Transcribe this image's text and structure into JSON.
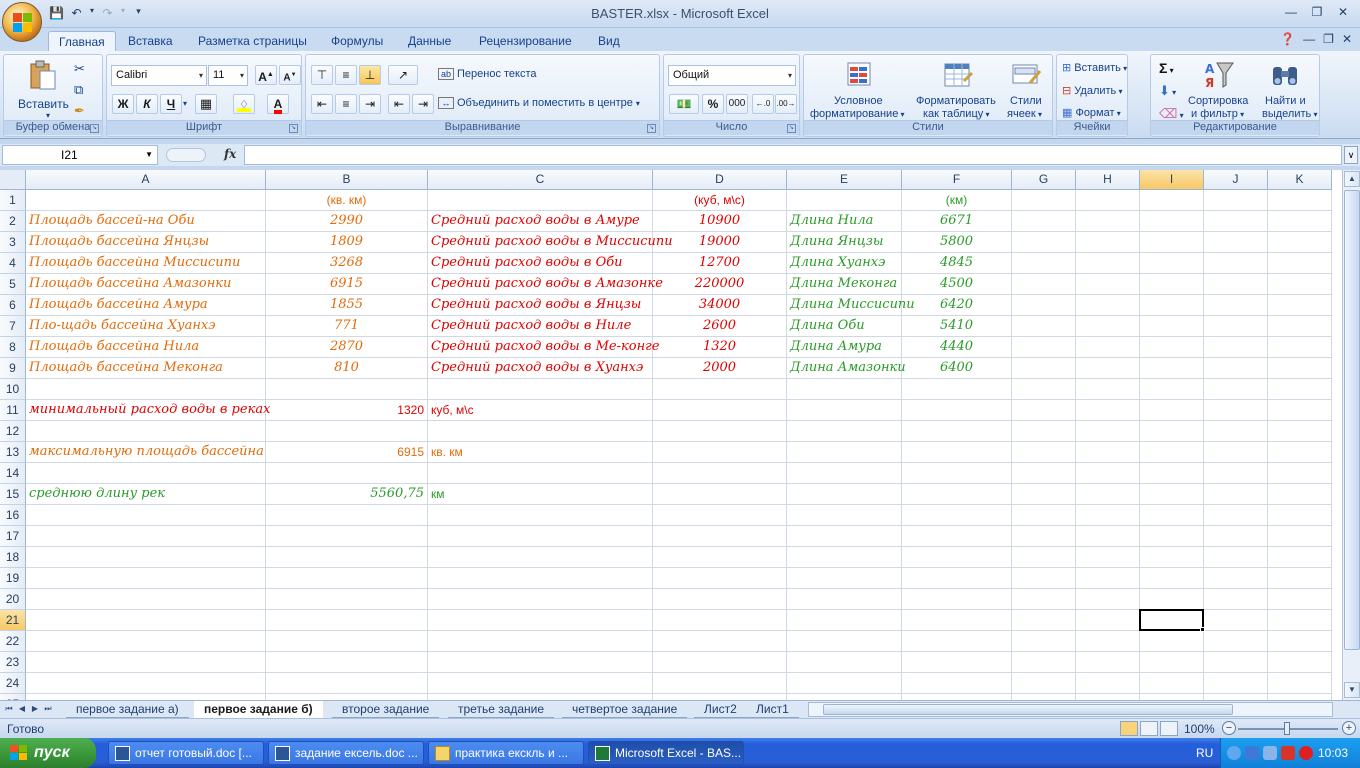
{
  "window": {
    "title": "BASTER.xlsx - Microsoft Excel"
  },
  "ribbon_tabs": [
    "Главная",
    "Вставка",
    "Разметка страницы",
    "Формулы",
    "Данные",
    "Рецензирование",
    "Вид"
  ],
  "ribbon": {
    "clipboard": {
      "label": "Буфер обмена",
      "paste": "Вставить"
    },
    "font": {
      "label": "Шрифт",
      "name": "Calibri",
      "size": "11",
      "bold": "Ж",
      "italic": "К",
      "underline": "Ч",
      "grow": "A",
      "shrink": "A",
      "color": "A"
    },
    "alignment": {
      "label": "Выравнивание",
      "wrap": "Перенос текста",
      "merge": "Объединить и поместить в центре"
    },
    "number": {
      "label": "Число",
      "format": "Общий",
      "percent": "%",
      "thousands": "000"
    },
    "styles": {
      "label": "Стили",
      "conditional_1": "Условное",
      "conditional_2": "форматирование",
      "table_1": "Форматировать",
      "table_2": "как таблицу",
      "cell_1": "Стили",
      "cell_2": "ячеек"
    },
    "cells": {
      "label": "Ячейки",
      "insert": "Вставить",
      "delete": "Удалить",
      "format": "Формат"
    },
    "editing": {
      "label": "Редактирование",
      "sigma": "Σ",
      "sort_1": "Сортировка",
      "sort_2": "и фильтр",
      "find_1": "Найти и",
      "find_2": "выделить"
    }
  },
  "formula_bar": {
    "name_box": "I21",
    "fx": "fx",
    "formula": ""
  },
  "columns": [
    "A",
    "B",
    "C",
    "D",
    "E",
    "F",
    "G",
    "H",
    "I",
    "J",
    "K"
  ],
  "rows": [
    "1",
    "2",
    "3",
    "4",
    "5",
    "6",
    "7",
    "8",
    "9",
    "10",
    "11",
    "12",
    "13",
    "14",
    "15",
    "16",
    "17",
    "18",
    "19",
    "20",
    "21",
    "22",
    "23",
    "24",
    "25"
  ],
  "cells": {
    "B1": "(кв. км)",
    "D1": "(куб, м\\с)",
    "F1": "(км)",
    "A2": "Площадь бассей-на Оби",
    "B2": "2990",
    "C2": "Средний расход воды в Амуре",
    "D2": "10900",
    "E2": "Длина Нила",
    "F2": "6671",
    "A3": "Площадь бассейна Янцзы",
    "B3": "1809",
    "C3": "Средний расход воды в Миссисипи",
    "D3": "19000",
    "E3": "Длина Янцзы",
    "F3": "5800",
    "A4": "Площадь бассейна Миссисипи",
    "B4": "3268",
    "C4": "Средний расход воды в Оби",
    "D4": "12700",
    "E4": "Длина Хуанхэ",
    "F4": "4845",
    "A5": "Площадь бассейна Амазонки",
    "B5": "6915",
    "C5": "Средний расход воды в Амазонке",
    "D5": "220000",
    "E5": "Длина Меконга",
    "F5": "4500",
    "A6": "Площадь бассейна Амура",
    "B6": "1855",
    "C6": "Средний расход воды в Янцзы",
    "D6": "34000",
    "E6": "Длина Миссисипи",
    "F6": "6420",
    "A7": "Пло-щадь бассейна Хуанхэ",
    "B7": "771",
    "C7": "Средний расход воды в Ниле",
    "D7": "2600",
    "E7": "Длина Оби",
    "F7": "5410",
    "A8": "Площадь бассейна Нила",
    "B8": "2870",
    "C8": "Средний расход воды в Ме-конге",
    "D8": "1320",
    "E8": "Длина Амура",
    "F8": "4440",
    "A9": "Площадь бассейна Меконга",
    "B9": "810",
    "C9": "Средний расход воды в Хуанхэ",
    "D9": "2000",
    "E9": "Длина Амазонки",
    "F9": "6400",
    "A11": "минимальный расход воды в реках",
    "B11": "1320",
    "C11": "куб, м\\с",
    "A13": "максимальную площадь бассейна",
    "B13": "6915",
    "C13": "кв. км",
    "A15": "среднюю длину рек",
    "B15": "5560,75",
    "C15": "км"
  },
  "selected_cell": "I21",
  "sheet_tabs": [
    "первое задание а)",
    "первое задание б)",
    "второе задание",
    "третье задание",
    "четвертое задание",
    "Лист2",
    "Лист1"
  ],
  "active_sheet": "первое задание б)",
  "status": {
    "text": "Готово",
    "zoom": "100%"
  },
  "taskbar": {
    "start": "пуск",
    "items": [
      "отчет готовый.doc [...",
      "задание ексель.doc ...",
      "практика екскль и ...",
      "Microsoft Excel - BAS..."
    ],
    "lang": "RU",
    "clock": "10:03"
  },
  "colors": {
    "orange": "#e26b0a",
    "red": "#e00000",
    "green": "#2a9a2a"
  }
}
